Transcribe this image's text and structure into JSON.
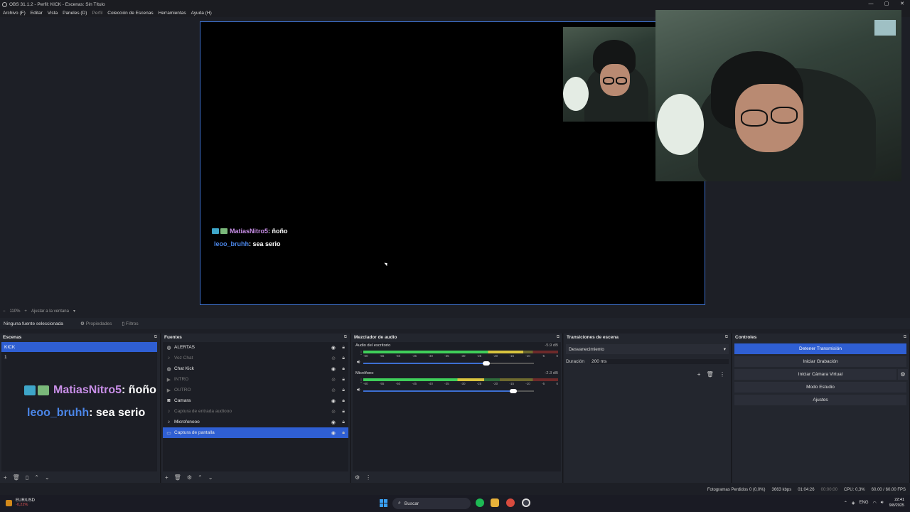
{
  "window": {
    "title": "OBS 31.1.2 - Perfil: KICK - Escenas: Sin Título",
    "controls": [
      "—",
      "▢",
      "✕"
    ]
  },
  "menu": {
    "items": [
      "Archivo (F)",
      "Editar",
      "Vista",
      "Paneles (D)",
      "Perfil",
      "Colección de Escenas",
      "Herramientas",
      "Ayuda (H)"
    ]
  },
  "preview": {
    "chat": [
      {
        "user": "MatiasNitro5",
        "message": " : ñoño"
      },
      {
        "user": "leoo_bruhh",
        "message": " : sea serio"
      }
    ]
  },
  "zoombar": {
    "zoom": "110%",
    "fit_label": "Ajustar a la ventana"
  },
  "propbar": {
    "no_selection": "Ninguna fuente seleccionada",
    "properties": "Propiedades",
    "filters": "Filtros"
  },
  "scenes": {
    "title": "Escenas",
    "items": [
      "KICK",
      "1"
    ]
  },
  "sources": {
    "title": "Fuentes",
    "items": [
      {
        "name": "ALERTAS",
        "icon": "globe-icon",
        "visible": true
      },
      {
        "name": "Voz Chat",
        "icon": "mic-icon",
        "visible": false
      },
      {
        "name": "Chat Kick",
        "icon": "globe-icon",
        "visible": true
      },
      {
        "name": "INTRO",
        "icon": "play-icon",
        "visible": false
      },
      {
        "name": "OUTRO",
        "icon": "play-icon",
        "visible": false
      },
      {
        "name": "Camara",
        "icon": "camera-icon",
        "visible": true
      },
      {
        "name": "Captura de entrada audiooo",
        "icon": "mic-icon",
        "visible": false
      },
      {
        "name": "Microfonooo",
        "icon": "mic-icon",
        "visible": true
      },
      {
        "name": "Captura de pantalla",
        "icon": "monitor-icon",
        "visible": true
      }
    ]
  },
  "mixer": {
    "title": "Mezclador de audio",
    "ticks": [
      "-60",
      "-55",
      "-50",
      "-45",
      "-40",
      "-35",
      "-30",
      "-25",
      "-20",
      "-15",
      "-10",
      "-5",
      "0"
    ],
    "channels": [
      {
        "name": "Audio del escritorio",
        "db": "-5.9 dB",
        "level": 0.82,
        "volume": 0.72
      },
      {
        "name": "Micrófono",
        "db": "-2.3 dB",
        "level": 0.62,
        "volume": 0.88
      }
    ]
  },
  "transitions": {
    "title": "Transiciones de escena",
    "selected": "Desvanecimiento",
    "duration_label": "Duración",
    "duration_value": "200 ms"
  },
  "controls": {
    "title": "Controles",
    "buttons": [
      "Detener Transmisión",
      "Iniciar Grabación",
      "Iniciar Cámara Virtual",
      "Modo Estudio",
      "Ajustes"
    ]
  },
  "status": {
    "dropped": "Fotogramas Perdidos 0 (0,0%)",
    "bitrate": "3663 kbps",
    "live_time": "01:04:26",
    "rec_time": "00:00:00",
    "cpu": "CPU: 0,3%",
    "fps": "60.00 / 60.00 FPS"
  },
  "taskbar": {
    "ticker_name": "EUR/USD",
    "ticker_change": "-0,22%",
    "search": "Buscar",
    "lang": "ENG",
    "time": "22:41",
    "date": "9/8/2025"
  },
  "colors": {
    "accent": "#2f5fd3",
    "canvas_border": "#3d6fc9",
    "user1": "#c98fe8",
    "user2": "#4b86e8"
  }
}
